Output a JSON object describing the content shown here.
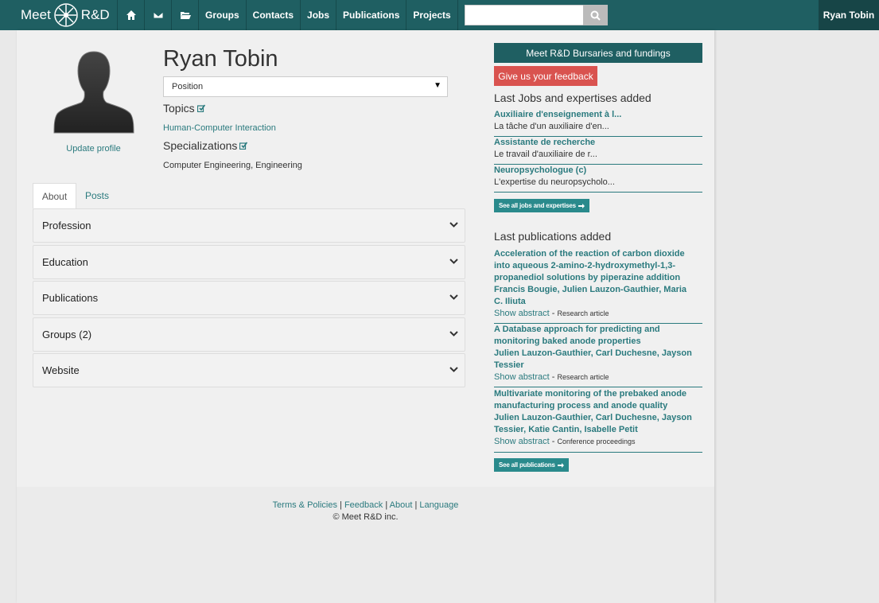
{
  "nav": {
    "logo_left": "Meet",
    "logo_right": "R&D",
    "items": [
      "Groups",
      "Contacts",
      "Jobs",
      "Publications",
      "Projects"
    ],
    "search": {
      "value": "",
      "placeholder": ""
    },
    "user": "Ryan Tobin"
  },
  "profile": {
    "name": "Ryan Tobin",
    "update_label": "Update profile",
    "position_placeholder": "Position",
    "topics_label": "Topics",
    "topic": "Human-Computer Interaction",
    "specializations_label": "Specializations",
    "specializations": "Computer Engineering, Engineering"
  },
  "tabs": [
    "About",
    "Posts"
  ],
  "accordion": [
    "Profession",
    "Education",
    "Publications",
    "Groups (2)",
    "Website"
  ],
  "sidebar": {
    "bursaries_btn": "Meet R&D Bursaries and fundings",
    "feedback_btn": "Give us your feedback",
    "jobs_heading": "Last Jobs and expertises added",
    "jobs": [
      {
        "title": "Auxiliaire d'enseignement à l...",
        "desc": "La tâche d'un auxiliaire d'en..."
      },
      {
        "title": "Assistante de recherche",
        "desc": "Le travail d'auxiliaire de r..."
      },
      {
        "title": "Neuropsychologue (c)",
        "desc": "L'expertise du neuropsycholo..."
      }
    ],
    "see_all_jobs": "See all jobs and expertises",
    "pubs_heading": "Last publications added",
    "pubs": [
      {
        "title_lines": [
          "Acceleration of the reaction of carbon dioxide",
          "into aqueous 2-amino-2-hydroxymethyl-1,3-",
          "propanediol solutions by piperazine addition"
        ],
        "author_lines": [
          "Francis Bougie, Julien Lauzon-Gauthier, Maria",
          "C. Iliuta"
        ],
        "abstract": "Show abstract",
        "type": "Research article"
      },
      {
        "title_lines": [
          "A Database approach for predicting and",
          "monitoring baked anode properties"
        ],
        "author_lines": [
          "Julien Lauzon-Gauthier, Carl Duchesne, Jayson",
          "Tessier"
        ],
        "abstract": "Show abstract",
        "type": "Research article"
      },
      {
        "title_lines": [
          "Multivariate monitoring of the prebaked anode",
          "manufacturing process and anode quality"
        ],
        "author_lines": [
          "Julien Lauzon-Gauthier, Carl Duchesne, Jayson",
          "Tessier, Katie Cantin, Isabelle Petit"
        ],
        "abstract": "Show abstract",
        "type": "Conference proceedings"
      }
    ],
    "see_all_pubs": "See all publications"
  },
  "footer": {
    "links": [
      "Terms & Policies",
      "Feedback",
      "About",
      "Language"
    ],
    "copyright": "© Meet R&D inc."
  },
  "colors": {
    "nav": "#1f5f62",
    "accent": "#2a7a7e",
    "feedback": "#d9534f"
  }
}
